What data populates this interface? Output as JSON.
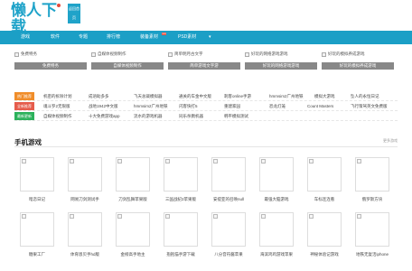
{
  "header": {
    "logo_cn": "懒人下载",
    "logo_en": "WWW.LANRENTAO.COM",
    "badge": "返回首页"
  },
  "nav": {
    "items": [
      "游戏",
      "软件",
      "专题",
      "排行榜",
      "装备素材",
      "PSD素材",
      "▾"
    ],
    "new_badge": "new"
  },
  "ads": [
    {
      "alt": "免费特务",
      "label": "免费特务"
    },
    {
      "alt": "自媒体视频制作",
      "label": "自媒体视频制作"
    },
    {
      "alt": "简单明月古文字",
      "label": "简单游戏文字游"
    },
    {
      "alt": "好玩的网络游戏游戏",
      "label": "好玩的网络游戏游戏"
    },
    {
      "alt": "好玩的模拟养成游戏",
      "label": "好玩的模拟养成游戏"
    }
  ],
  "rows": [
    {
      "tag": "热门推荐",
      "color": "#f08d2a",
      "cells": [
        "机密的拆除计划",
        "成语助多多",
        "飞天总裁模拟器",
        "通关的车金中文版",
        "刺客online手游",
        "hmmsim2广州地铁",
        "模拟大游戏",
        "坠人的永恒日记"
      ]
    },
    {
      "tag": "全新推荐",
      "color": "#e55c4b",
      "cells": [
        "魂斗罗2无限版",
        "战地1942中文版",
        "hmmsim2广州地铁",
        "闪客快打5",
        "重建家园",
        "恐龙灯笼",
        "Count Masters",
        "飞行策驾英文免费版"
      ]
    },
    {
      "tag": "最新更新",
      "color": "#2cb15b",
      "cells": [
        "自媒体视频制作",
        "十大免费游戏app",
        "流水的游戏机器",
        "同乐杀戮机器",
        "韩平模拟测试"
      ]
    }
  ],
  "section": {
    "title": "手机游戏",
    "more": "更多游戏"
  },
  "apps_row1": [
    "暗恋日记",
    "网易刀剑测试手",
    "刀剑乱舞苹果版",
    "三国战纪2苹果版",
    "安提亚的召唤null",
    "最强大脑游戏",
    "车标连连看",
    "俄罗斯方块"
  ],
  "apps_row2": [
    "糖果工厂",
    "体育恩贝手hd版",
    "金榜高手地主",
    "抱抱猫手游下载",
    "八分音符酱苹果",
    "海滨鸡鸡游戏苹果",
    "神秘体验记游戏",
    "地铁无复活iphone"
  ]
}
